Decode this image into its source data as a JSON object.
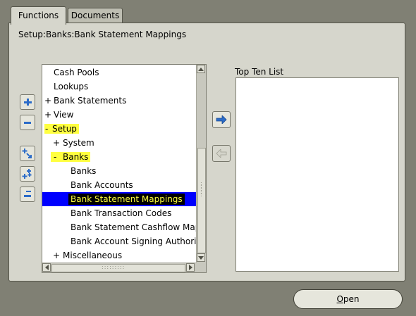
{
  "tabs": [
    {
      "label": "Functions",
      "active": true
    },
    {
      "label": "Documents",
      "active": false
    }
  ],
  "path_label": "Setup:Banks:Bank Statement Mappings",
  "tree": {
    "items": [
      {
        "prefix": "",
        "label": "Cash Pools",
        "level": 0
      },
      {
        "prefix": "",
        "label": "Lookups",
        "level": 0
      },
      {
        "prefix": "+",
        "label": "Bank Statements",
        "level": 0
      },
      {
        "prefix": "+",
        "label": "View",
        "level": 0
      },
      {
        "prefix": "-",
        "label": "Setup",
        "level": 0,
        "highlight": true
      },
      {
        "prefix": "+",
        "label": "System",
        "level": 1
      },
      {
        "prefix": "-",
        "label": "Banks",
        "level": 1,
        "highlight": true
      },
      {
        "prefix": "",
        "label": "Banks",
        "level": 2
      },
      {
        "prefix": "",
        "label": "Bank Accounts",
        "level": 2
      },
      {
        "prefix": "",
        "label": "Bank Statement Mappings",
        "level": 2,
        "selected": true
      },
      {
        "prefix": "",
        "label": "Bank Transaction Codes",
        "level": 2
      },
      {
        "prefix": "",
        "label": "Bank Statement Cashflow Map",
        "level": 2
      },
      {
        "prefix": "",
        "label": "Bank Account Signing Authorit",
        "level": 2
      },
      {
        "prefix": "+",
        "label": "Miscellaneous",
        "level": 1
      }
    ]
  },
  "side_buttons": [
    {
      "icon": "plus-icon"
    },
    {
      "icon": "minus-icon"
    },
    {
      "icon": "expand-branch-icon"
    },
    {
      "icon": "expand-all-icon"
    },
    {
      "icon": "collapse-all-icon"
    }
  ],
  "top_ten": {
    "label": "Top Ten List",
    "items": []
  },
  "open_button": {
    "first": "O",
    "rest": "pen"
  },
  "colors": {
    "background": "#808074",
    "panel": "#d6d6cc",
    "highlight": "#ffff40",
    "selection": "#0000ff",
    "arrow": "#2c6cc8"
  }
}
